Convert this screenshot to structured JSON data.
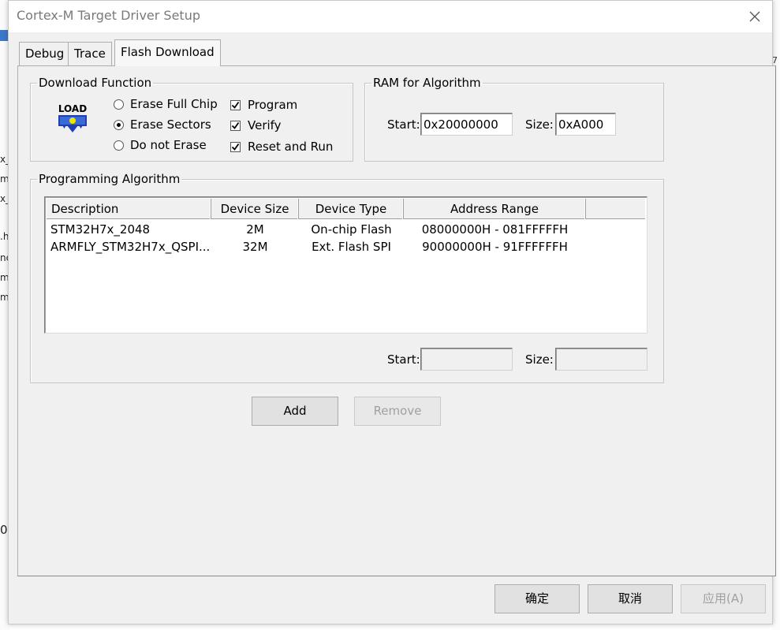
{
  "window": {
    "title": "Cortex-M Target Driver Setup"
  },
  "background_fragments": {
    "left": [
      "x_",
      "m",
      "x_",
      ".h",
      "nc",
      "m",
      "m",
      "0"
    ],
    "right": [
      "7"
    ]
  },
  "tabs": [
    {
      "label": "Debug",
      "active": false
    },
    {
      "label": "Trace",
      "active": false
    },
    {
      "label": "Flash Download",
      "active": true
    }
  ],
  "download_function": {
    "legend": "Download Function",
    "icon_text": "LOAD",
    "erase_options": [
      {
        "label": "Erase Full Chip",
        "selected": false
      },
      {
        "label": "Erase Sectors",
        "selected": true
      },
      {
        "label": "Do not Erase",
        "selected": false
      }
    ],
    "checks": [
      {
        "label": "Program",
        "checked": true
      },
      {
        "label": "Verify",
        "checked": true
      },
      {
        "label": "Reset and Run",
        "checked": true
      }
    ]
  },
  "ram_for_algorithm": {
    "legend": "RAM for Algorithm",
    "start_label": "Start:",
    "start_value": "0x20000000",
    "size_label": "Size:",
    "size_value": "0xA000"
  },
  "programming_algorithm": {
    "legend": "Programming Algorithm",
    "columns": [
      "Description",
      "Device Size",
      "Device Type",
      "Address Range"
    ],
    "rows": [
      [
        "STM32H7x_2048",
        "2M",
        "On-chip Flash",
        "08000000H - 081FFFFFH"
      ],
      [
        "ARMFLY_STM32H7x_QSPI...",
        "32M",
        "Ext. Flash SPI",
        "90000000H - 91FFFFFFH"
      ]
    ],
    "start_label": "Start:",
    "start_value": "",
    "size_label": "Size:",
    "size_value": ""
  },
  "buttons": {
    "add": "Add",
    "remove": "Remove",
    "ok": "确定",
    "cancel": "取消",
    "apply": "应用(A)"
  }
}
